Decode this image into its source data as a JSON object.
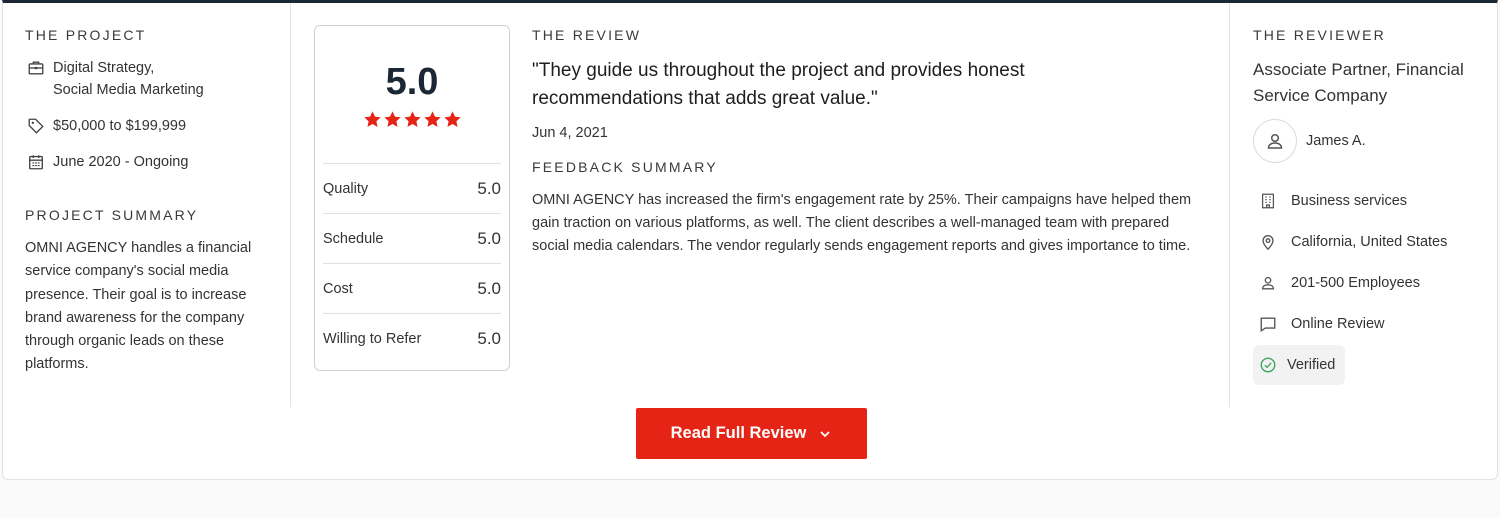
{
  "project": {
    "section_title": "THE PROJECT",
    "services_line1": "Digital Strategy,",
    "services_line2": "Social Media Marketing",
    "budget": "$50,000 to $199,999",
    "dates": "June 2020 - Ongoing",
    "summary_title": "PROJECT SUMMARY",
    "summary": "OMNI AGENCY handles a financial service company's social media presence. Their goal is to increase brand awareness for the company through organic leads on these platforms.",
    "icons": [
      "briefcase-icon",
      "tag-icon",
      "calendar-icon"
    ]
  },
  "rating": {
    "overall": "5.0",
    "stars": 5,
    "star_color": "#e62415",
    "scores": [
      {
        "label": "Quality",
        "value": "5.0"
      },
      {
        "label": "Schedule",
        "value": "5.0"
      },
      {
        "label": "Cost",
        "value": "5.0"
      },
      {
        "label": "Willing to Refer",
        "value": "5.0"
      }
    ]
  },
  "review": {
    "section_title": "THE REVIEW",
    "quote": "\"They guide us throughout the project and provides honest recommendations that adds great value.\"",
    "date": "Jun 4, 2021",
    "feedback_title": "FEEDBACK SUMMARY",
    "feedback": "OMNI AGENCY has increased the firm's engagement rate by 25%. Their campaigns have helped them gain traction on various platforms, as well. The client describes a well-managed team with prepared social media calendars. The vendor regularly sends engagement reports and gives importance to time."
  },
  "reviewer": {
    "section_title": "THE REVIEWER",
    "title": "Associate Partner, Financial Service Company",
    "name": "James A.",
    "industry": "Business services",
    "location": "California, United States",
    "size": "201-500 Employees",
    "review_type": "Online Review",
    "verified": "Verified",
    "verified_color": "#3aa35b",
    "icons": [
      "user-icon",
      "building-icon",
      "location-pin-icon",
      "person-icon",
      "chat-bubble-icon",
      "check-circle-icon"
    ]
  },
  "cta": {
    "label": "Read Full Review",
    "color": "#e62415"
  }
}
